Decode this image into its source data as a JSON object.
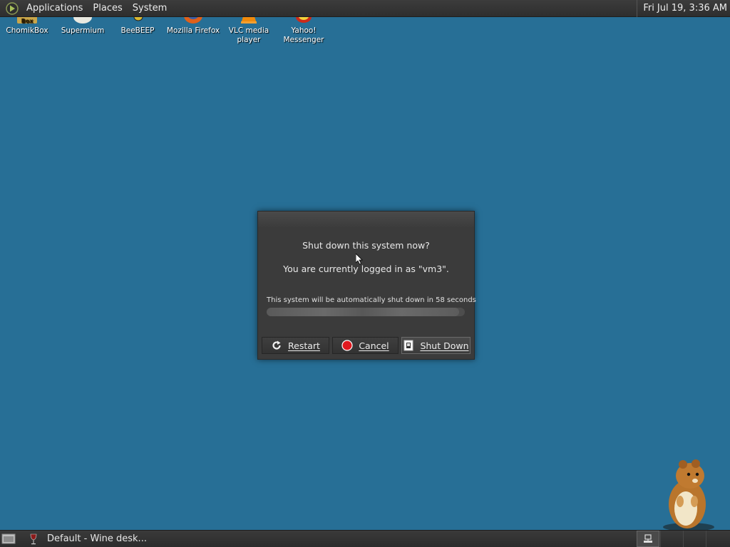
{
  "top_panel": {
    "menus": [
      "Applications",
      "Places",
      "System"
    ],
    "clock": "Fri Jul 19,  3:36 AM"
  },
  "desktop_icons": [
    {
      "label": "ChomikBox",
      "icon": "chomikbox-icon"
    },
    {
      "label": "Supermium",
      "icon": "supermium-icon"
    },
    {
      "label": "BeeBEEP",
      "icon": "beebeep-icon"
    },
    {
      "label": "Mozilla Firefox",
      "icon": "firefox-icon"
    },
    {
      "label": "VLC media player",
      "icon": "vlc-icon"
    },
    {
      "label": "Yahoo! Messenger",
      "icon": "yahoo-messenger-icon"
    }
  ],
  "dialog": {
    "question": "Shut down this system now?",
    "logged_in": "You are currently logged in as \"vm3\".",
    "countdown": "This system will be automatically shut down in 58 seconds",
    "progress": 0.97,
    "buttons": {
      "restart": "Restart",
      "cancel": "Cancel",
      "shutdown": "Shut Down"
    }
  },
  "taskbar": {
    "task_label": "Default - Wine desk..."
  },
  "colors": {
    "desktop": "#276f96",
    "panel": "#333333",
    "cancel_icon": "#e0191f"
  }
}
